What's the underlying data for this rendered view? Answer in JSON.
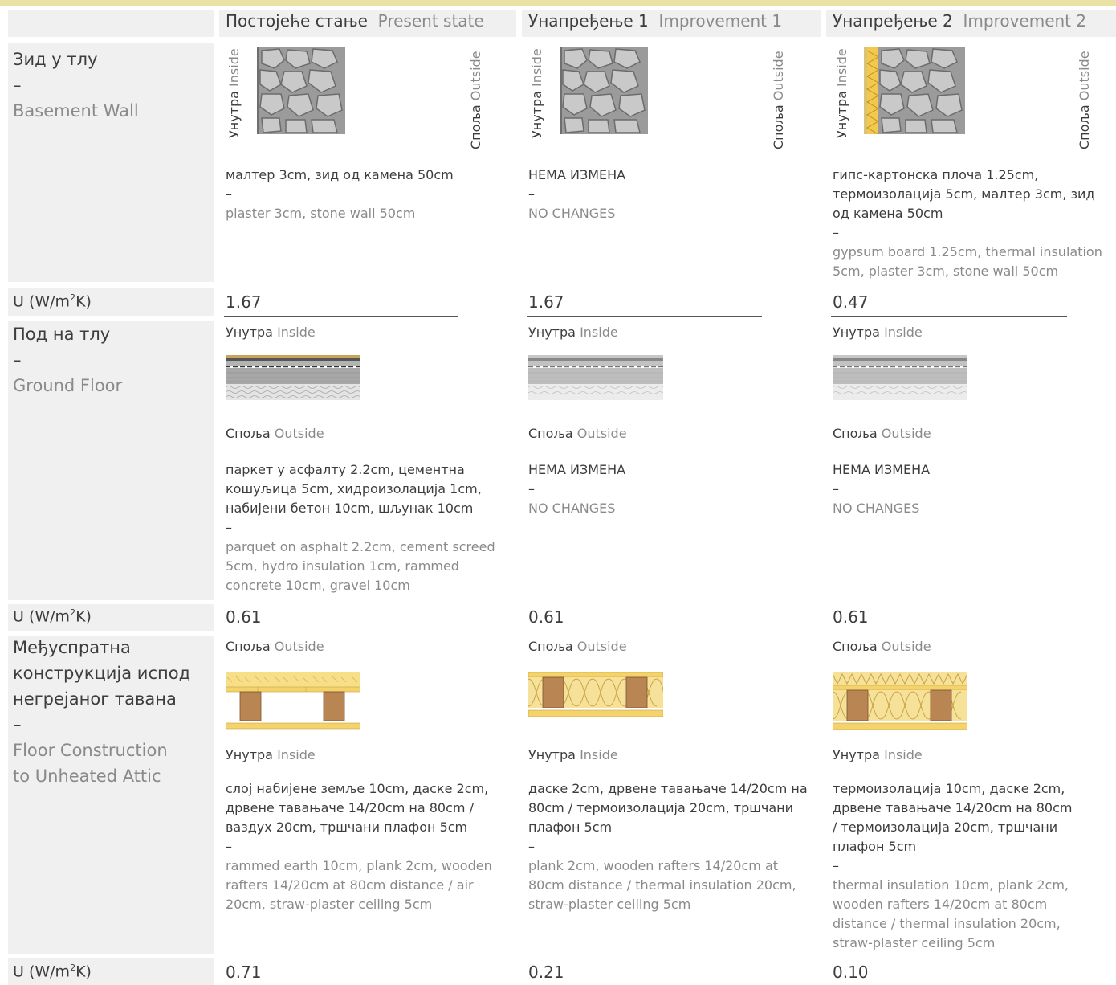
{
  "header": {
    "columns": [
      {
        "sr": "Постојеће стање",
        "en": "Present state"
      },
      {
        "sr": "Унапређење 1",
        "en": "Improvement 1"
      },
      {
        "sr": "Унапређење 2",
        "en": "Improvement 2"
      }
    ]
  },
  "labels": {
    "inside_sr": "Унутра",
    "inside_en": "Inside",
    "outside_sr": "Споља",
    "outside_en": "Outside",
    "dash": "–",
    "u_label": "U (W/m",
    "u_sup": "2",
    "u_end": "K)"
  },
  "rows": [
    {
      "title_sr": "Зид у тлу",
      "title_en": "Basement Wall",
      "cells": [
        {
          "sr": "малтер 3cm, зид од камена 50cm",
          "en": "plaster 3cm, stone wall 50cm",
          "u": "1.67"
        },
        {
          "sr": "НЕМА ИЗМЕНА",
          "en": "NO CHANGES",
          "u": "1.67"
        },
        {
          "sr": "гипс-картонска плоча 1.25cm, термоизолација 5cm, малтер 3cm, зид од камена 50cm",
          "en": "gypsum board 1.25cm, thermal insulation 5cm, plaster 3cm, stone wall 50cm",
          "u": "0.47"
        }
      ]
    },
    {
      "title_sr": "Под на тлу",
      "title_en": "Ground Floor",
      "cells": [
        {
          "sr": "паркет у асфалту 2.2cm, цементна кошуљица 5cm, хидроизолација 1cm, набијени бетон 10cm, шљунак 10cm",
          "en": "parquet on asphalt 2.2cm, cement screed 5cm, hydro insulation 1cm, rammed concrete 10cm, gravel 10cm",
          "u": "0.61"
        },
        {
          "sr": "НЕМА ИЗМЕНА",
          "en": "NO CHANGES",
          "u": "0.61"
        },
        {
          "sr": "НЕМА ИЗМЕНА",
          "en": "NO CHANGES",
          "u": "0.61"
        }
      ]
    },
    {
      "title_sr_1": "Међуспратна",
      "title_sr_2": "конструкција испод",
      "title_sr_3": "негрејаног тавана",
      "title_en_1": "Floor Construction",
      "title_en_2": "to Unheated Attic",
      "cells": [
        {
          "sr": "слој набијене земље 10cm, даске 2cm, дрвене тавањаче 14/20cm на 80cm / ваздух 20cm, тршчани плафон 5cm",
          "en": "rammed earth 10cm, plank 2cm, wooden rafters 14/20cm at 80cm distance / air 20cm, straw-plaster ceiling 5cm",
          "u": "0.71"
        },
        {
          "sr": "даске 2cm, дрвене тавањаче 14/20cm на 80cm / термоизолација 20cm, тршчани плафон 5cm",
          "en": "plank 2cm, wooden rafters 14/20cm at 80cm distance / thermal insulation 20cm, straw-plaster ceiling 5cm",
          "u": "0.21"
        },
        {
          "sr": "термоизолација 10cm, даске 2cm, дрвене тавањаче 14/20cm на 80cm / термоизолација 20cm, тршчани плафон 5cm",
          "en": "thermal insulation 10cm, plank 2cm, wooden rafters 14/20cm at 80cm distance / thermal insulation 20cm, straw-plaster ceiling 5cm",
          "u": "0.10"
        }
      ]
    }
  ],
  "colors": {
    "label_bg": "#f0f0f0",
    "top_band": "#e9e2a4",
    "stone": "#b9b9b9",
    "insulation": "#f2d77a",
    "wood": "#b98553"
  }
}
